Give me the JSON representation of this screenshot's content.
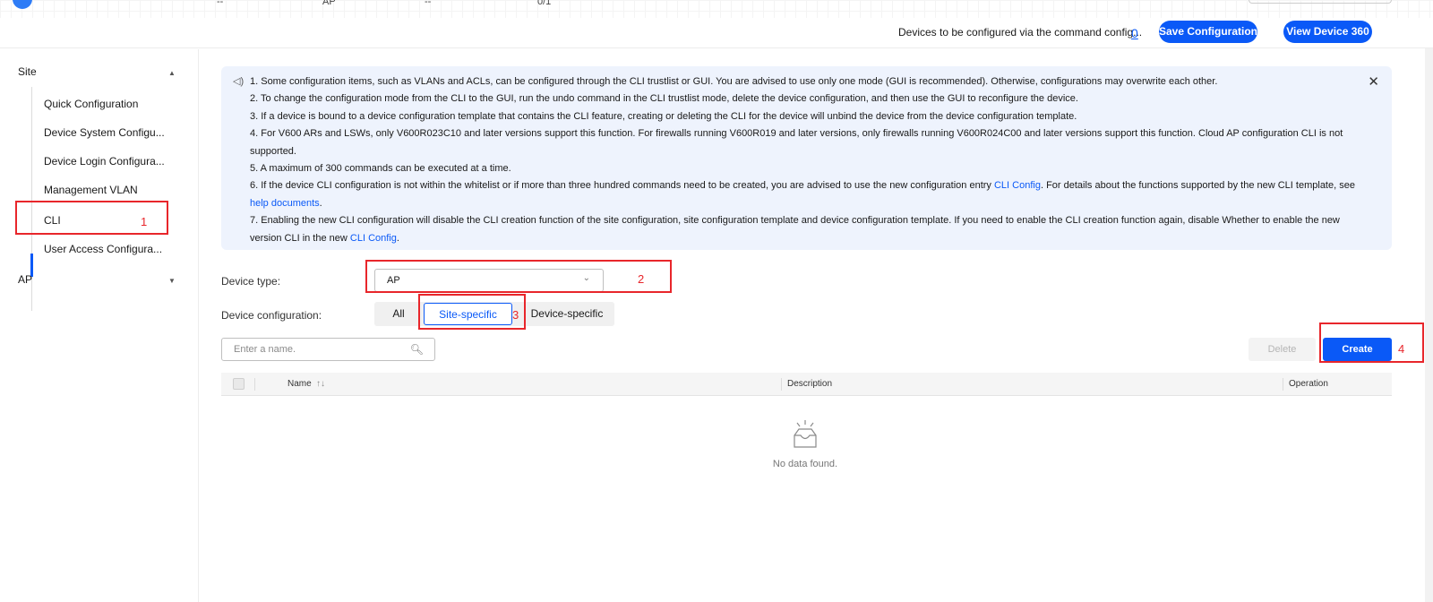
{
  "header": {
    "top_fragments": [
      "--",
      "AP",
      "--",
      "0/1"
    ],
    "devices_label": "Devices to be configured via the command config...",
    "devices_count": "0",
    "save_label": "Save Configuration",
    "view_label": "View Device 360"
  },
  "sidebar": {
    "site_label": "Site",
    "items": [
      {
        "label": "Quick Configuration"
      },
      {
        "label": "Device System Configu..."
      },
      {
        "label": "Device Login Configura..."
      },
      {
        "label": "Management VLAN"
      },
      {
        "label": "CLI"
      },
      {
        "label": "User Access Configura..."
      }
    ],
    "ap_label": "AP"
  },
  "notice": {
    "line1": "1. Some configuration items, such as VLANs and ACLs, can be configured through the CLI trustlist or GUI. You are advised to use only one mode (GUI is recommended). Otherwise, configurations may overwrite each other.",
    "line2": "2. To change the configuration mode from the CLI to the GUI, run the undo command in the CLI trustlist mode, delete the device configuration, and then use the GUI to reconfigure the device.",
    "line3": "3. If a device is bound to a device configuration template that contains the CLI feature, creating or deleting the CLI for the device will unbind the device from the device configuration template.",
    "line4": "4. For V600 ARs and LSWs, only V600R023C10 and later versions support this function. For firewalls running V600R019 and later versions, only firewalls running V600R024C00 and later versions support this function. Cloud AP configuration CLI is not supported.",
    "line5": "5. A maximum of 300 commands can be executed at a time.",
    "line6_pre": "6. If the device CLI configuration is not within the whitelist or if more than three hundred commands need to be created, you are advised to use the new configuration entry ",
    "line6_link1": "CLI Config",
    "line6_mid": ". For details about the functions supported by the new CLI template, see ",
    "line6_link2": "help documents",
    "line6_end": ".",
    "line7_pre": "7. Enabling the new CLI configuration will disable the CLI creation function of the site configuration, site configuration template and device configuration template. If you need to enable the CLI creation function again, disable Whether to enable the new version CLI in the new ",
    "line7_link": "CLI Config",
    "line7_end": "."
  },
  "form": {
    "device_type_label": "Device type:",
    "device_type_value": "AP",
    "device_config_label": "Device configuration:",
    "segments": [
      "All",
      "Site-specific",
      "Device-specific"
    ],
    "selected_segment": "Site-specific"
  },
  "toolbar": {
    "search_placeholder": "Enter a name.",
    "delete_label": "Delete",
    "create_label": "Create"
  },
  "table": {
    "columns": [
      "Name",
      "Description",
      "Operation"
    ],
    "sort_icon": "↑↓",
    "empty_text": "No data found."
  },
  "annotations": [
    "1",
    "2",
    "3",
    "4"
  ],
  "colors": {
    "accent": "#0a59f7",
    "annotation": "#e8262b",
    "notice_bg": "#eef3fd"
  }
}
